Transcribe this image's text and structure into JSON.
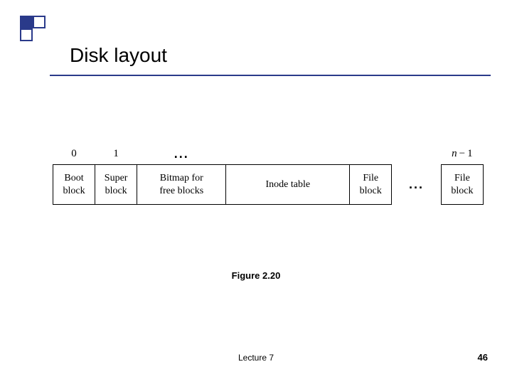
{
  "title": "Disk layout",
  "labels": {
    "idx0": "0",
    "idx1": "1",
    "dots_top": "...",
    "idxN_prefix": "n",
    "idxN_suffix": " − 1"
  },
  "cells": {
    "boot": "Boot\nblock",
    "super": "Super\nblock",
    "bitmap": "Bitmap for\nfree blocks",
    "inode": "Inode table",
    "file1": "File\nblock",
    "gap": "...",
    "file2": "File\nblock"
  },
  "caption": "Figure 2.20",
  "footer": {
    "lecture": "Lecture 7",
    "page": "46"
  },
  "chart_data": {
    "type": "table",
    "description": "Linear disk layout showing block sequence from index 0 to n-1",
    "blocks": [
      {
        "index": "0",
        "label": "Boot block"
      },
      {
        "index": "1",
        "label": "Super block"
      },
      {
        "index": "...",
        "label": "Bitmap for free blocks"
      },
      {
        "index": "",
        "label": "Inode table"
      },
      {
        "index": "",
        "label": "File block"
      },
      {
        "index": "...",
        "label": "..."
      },
      {
        "index": "n-1",
        "label": "File block"
      }
    ]
  }
}
